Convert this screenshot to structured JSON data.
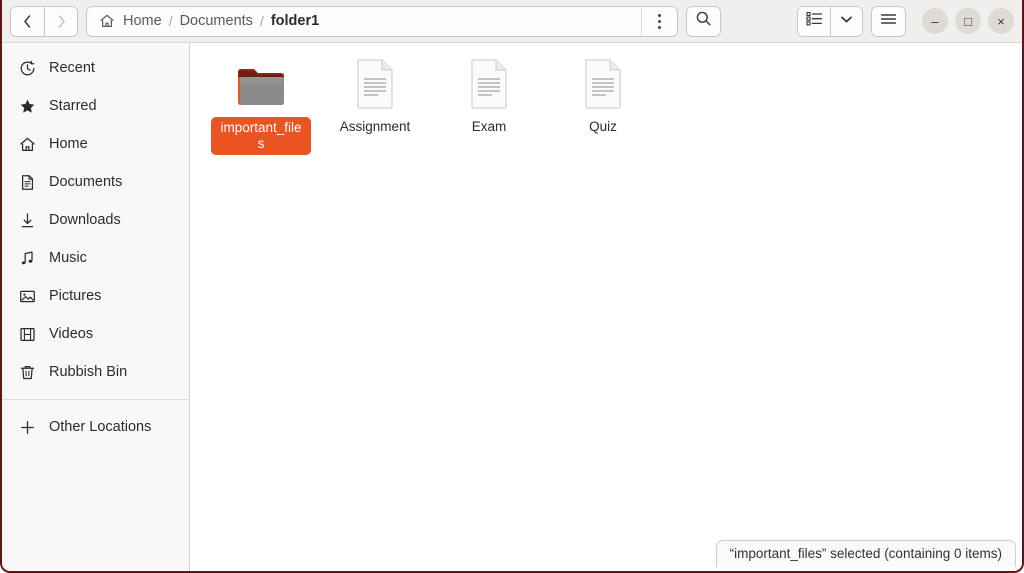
{
  "window": {
    "accent_color": "#e95420",
    "border_color": "#5e1616",
    "controls": {
      "minimize": "–",
      "maximize": "□",
      "close": "×"
    }
  },
  "header": {
    "back_label": "Back",
    "forward_label": "Forward",
    "breadcrumb": [
      {
        "label": "Home",
        "icon": "home-icon",
        "current": false
      },
      {
        "label": "Documents",
        "icon": "",
        "current": false
      },
      {
        "label": "folder1",
        "icon": "",
        "current": true
      }
    ],
    "separator": "/",
    "path_menu_label": "Path options",
    "search_label": "Search",
    "view_list_label": "List view",
    "view_chevron_label": "View options",
    "main_menu_label": "Main menu"
  },
  "sidebar": {
    "items": [
      {
        "label": "Recent",
        "icon": "clock-icon"
      },
      {
        "label": "Starred",
        "icon": "star-icon"
      },
      {
        "label": "Home",
        "icon": "home-icon"
      },
      {
        "label": "Documents",
        "icon": "document-icon"
      },
      {
        "label": "Downloads",
        "icon": "download-icon"
      },
      {
        "label": "Music",
        "icon": "music-note-icon"
      },
      {
        "label": "Pictures",
        "icon": "picture-icon"
      },
      {
        "label": "Videos",
        "icon": "film-icon"
      },
      {
        "label": "Rubbish Bin",
        "icon": "trash-icon"
      }
    ],
    "other_locations": {
      "label": "Other Locations",
      "icon": "plus-icon"
    }
  },
  "main": {
    "files": [
      {
        "name": "important_files",
        "type": "folder",
        "selected": true
      },
      {
        "name": "Assignment",
        "type": "document",
        "selected": false
      },
      {
        "name": "Exam",
        "type": "document",
        "selected": false
      },
      {
        "name": "Quiz",
        "type": "document",
        "selected": false
      }
    ]
  },
  "statusbar": {
    "text": "“important_files” selected  (containing 0 items)"
  }
}
